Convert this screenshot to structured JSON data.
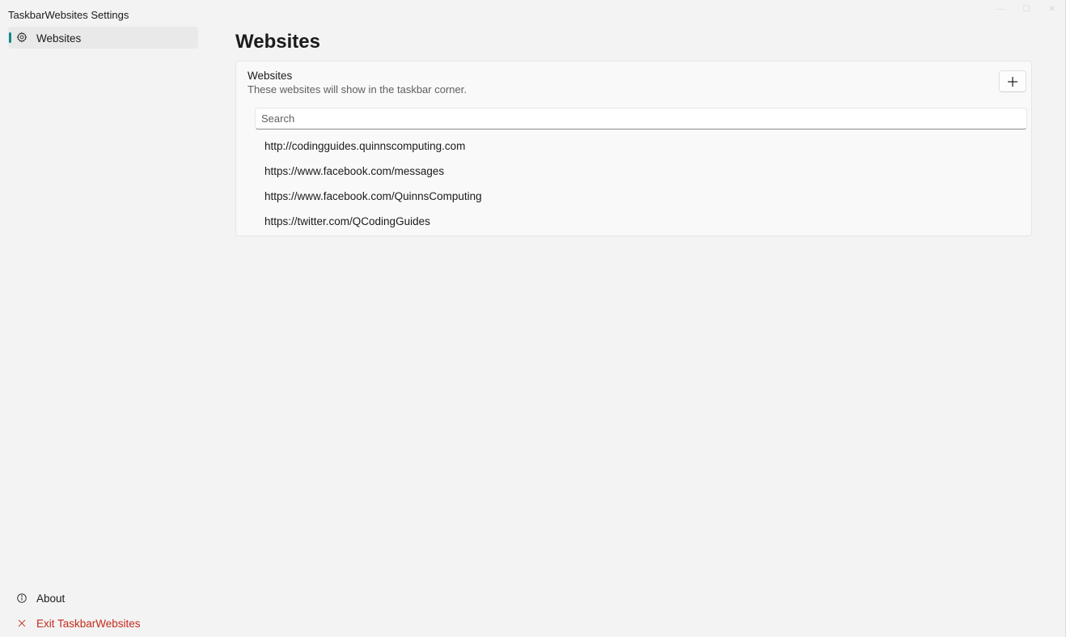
{
  "window": {
    "title": "TaskbarWebsites Settings",
    "caption": {
      "minimize": "—",
      "maximize": "☐",
      "close": "✕"
    }
  },
  "sidebar": {
    "items": [
      {
        "label": "Websites",
        "icon": "gear-icon",
        "selected": true
      }
    ],
    "footer": [
      {
        "label": "About",
        "icon": "info-icon"
      },
      {
        "label": "Exit TaskbarWebsites",
        "icon": "close-icon",
        "color": "#c42b1c"
      }
    ],
    "accent": "#0f8a8a"
  },
  "main": {
    "title": "Websites",
    "card": {
      "title": "Websites",
      "description": "These websites will show in the taskbar corner.",
      "add_icon": "plus-icon",
      "search": {
        "placeholder": "Search",
        "value": ""
      },
      "urls": [
        "http://codingguides.quinnscomputing.com",
        "https://www.facebook.com/messages",
        "https://www.facebook.com/QuinnsComputing",
        "https://twitter.com/QCodingGuides"
      ]
    }
  }
}
